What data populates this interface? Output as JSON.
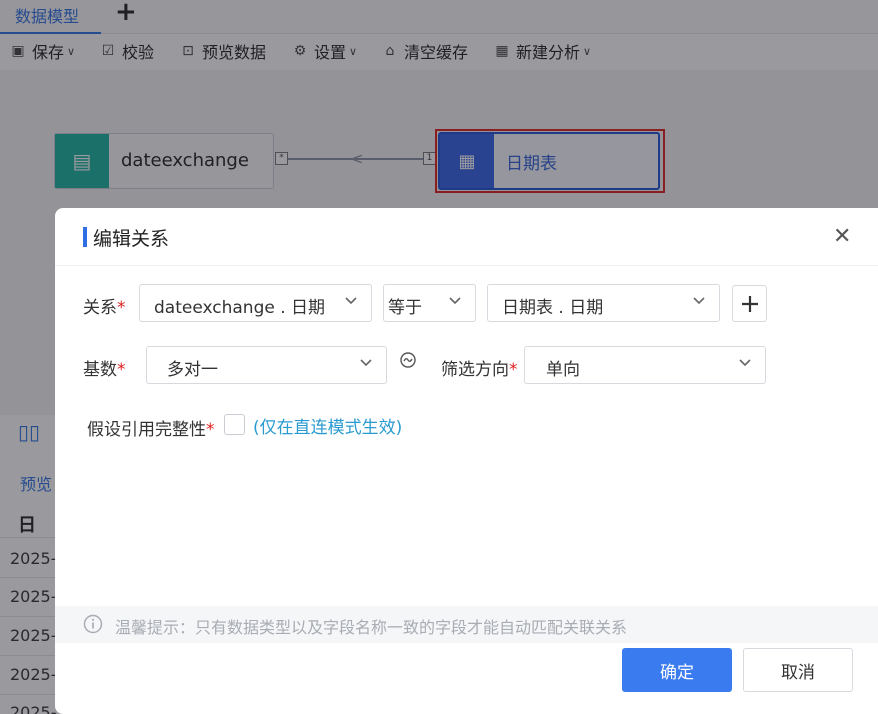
{
  "tabs": {
    "active": "数据模型",
    "add": "+"
  },
  "toolbar": [
    {
      "label": "保存",
      "icon": "save-icon",
      "dropdown": true
    },
    {
      "label": "校验",
      "icon": "check-icon",
      "dropdown": false
    },
    {
      "label": "预览数据",
      "icon": "preview-icon",
      "dropdown": false
    },
    {
      "label": "设置",
      "icon": "gear-icon",
      "dropdown": true
    },
    {
      "label": "清空缓存",
      "icon": "clear-icon",
      "dropdown": false
    },
    {
      "label": "新建分析",
      "icon": "analysis-icon",
      "dropdown": true
    }
  ],
  "canvas": {
    "left_node": "dateexchange",
    "right_node": "日期表",
    "left_marker": "*",
    "right_marker": "1"
  },
  "background_panel": {
    "tab": "预览",
    "header": "日",
    "rows": [
      "2025-",
      "2025-",
      "2025-",
      "2025-",
      "2025-"
    ]
  },
  "dialog": {
    "title": "编辑关系",
    "relation": {
      "label": "关系",
      "left_field": "dateexchange . 日期",
      "operator": "等于",
      "right_field": "日期表 . 日期"
    },
    "cardinality": {
      "label": "基数",
      "value": "多对一"
    },
    "filter_direction": {
      "label": "筛选方向",
      "value": "单向"
    },
    "referential_integrity": {
      "label": "假设引用完整性",
      "hint": "(仅在直连模式生效)",
      "checked": false
    },
    "tip": "温馨提示：只有数据类型以及字段名称一致的字段才能自动匹配关联关系",
    "ok": "确定",
    "cancel": "取消",
    "required_mark": "*"
  },
  "colors": {
    "accent": "#3b7bf0",
    "teal": "#18b4a0",
    "highlight": "#e0201b"
  }
}
